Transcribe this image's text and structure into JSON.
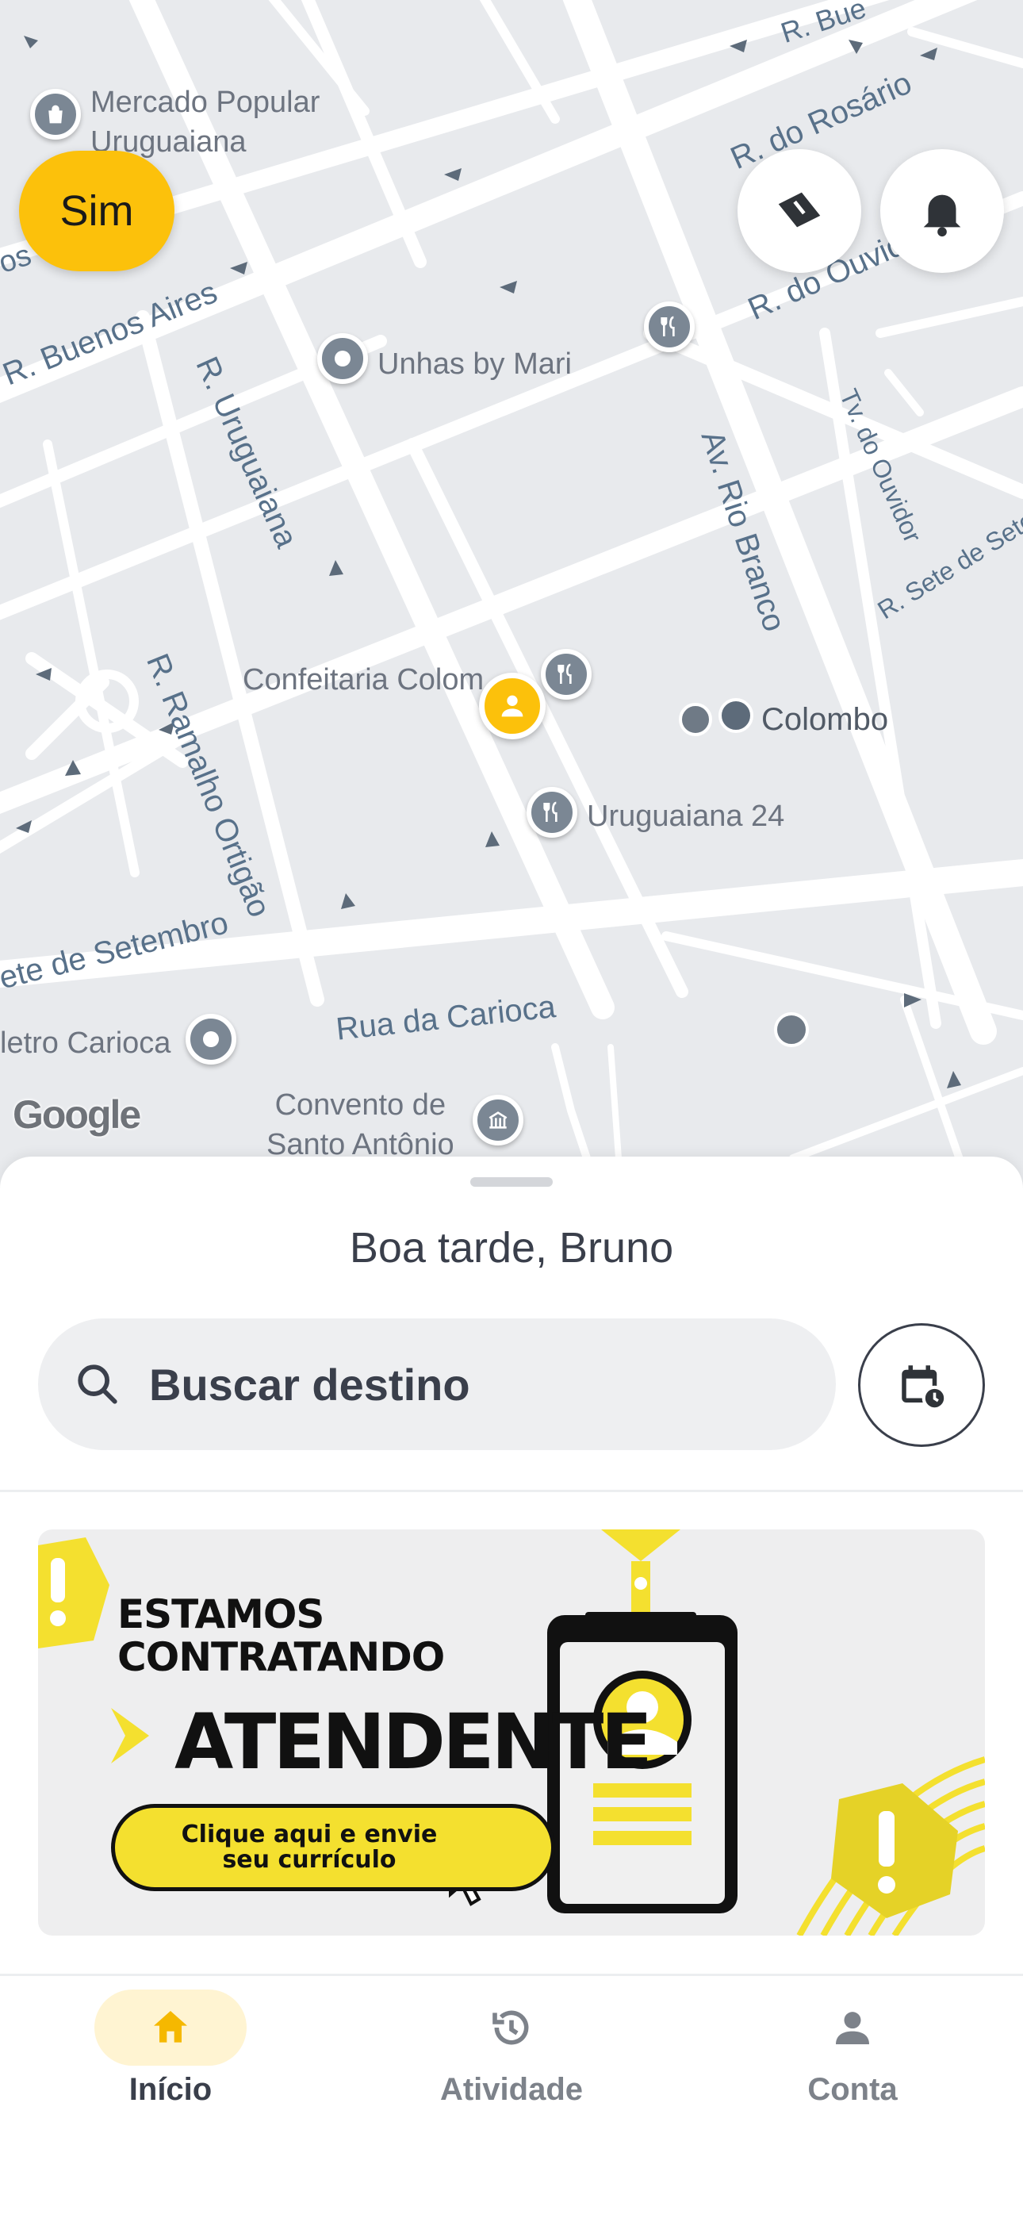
{
  "map": {
    "streets": [
      {
        "id": "r-buenos-aires",
        "text": "R. Buenos Aires"
      },
      {
        "id": "r-uruguaiana",
        "text": "R. Uruguaiana"
      },
      {
        "id": "r-ramalho",
        "text": "R. Ramalho Ortigão"
      },
      {
        "id": "av-rio-branco",
        "text": "Av. Rio Branco"
      },
      {
        "id": "r-rosario",
        "text": "R. do Rosário"
      },
      {
        "id": "r-ouvidor",
        "text": "R. do Ouvid"
      },
      {
        "id": "tv-ouvidor",
        "text": "Tv. do Ouvidor"
      },
      {
        "id": "r-sete-setembro-right",
        "text": "R. Sete de Sete"
      },
      {
        "id": "r-sete-setembro-left",
        "text": "ete de Setembro"
      },
      {
        "id": "rua-carioca",
        "text": "Rua da Carioca"
      },
      {
        "id": "r-bue-top",
        "text": "R. Bue"
      },
      {
        "id": "os-left",
        "text": "os"
      }
    ],
    "pois": {
      "mercado": "Mercado Popular\nUruguaiana",
      "unhas": "Unhas by Mari",
      "confeitaria": "Confeitaria Colom",
      "colombo": "Colombo",
      "uruguaiana24": "Uruguaiana 24",
      "metro": "letro Carioca",
      "convento": "Convento de\nSanto Antônio"
    },
    "attribution": "Google"
  },
  "top_controls": {
    "sim_label": "Sim"
  },
  "sheet": {
    "greeting": "Boa tarde, Bruno",
    "search_placeholder": "Buscar destino"
  },
  "banner": {
    "line1": "ESTAMOS",
    "line2": "CONTRATANDO",
    "role": "ATENDENTE",
    "cta_line1": "Clique aqui e envie",
    "cta_line2": "seu currículo",
    "accent_color": "#f4e02f"
  },
  "nav": {
    "items": [
      {
        "label": "Início",
        "icon": "home-icon",
        "active": true
      },
      {
        "label": "Atividade",
        "icon": "history-icon",
        "active": false
      },
      {
        "label": "Conta",
        "icon": "person-icon",
        "active": false
      }
    ]
  },
  "colors": {
    "brand": "#fcc10b",
    "map_bg": "#e8eaed",
    "text": "#3a3f4b"
  }
}
